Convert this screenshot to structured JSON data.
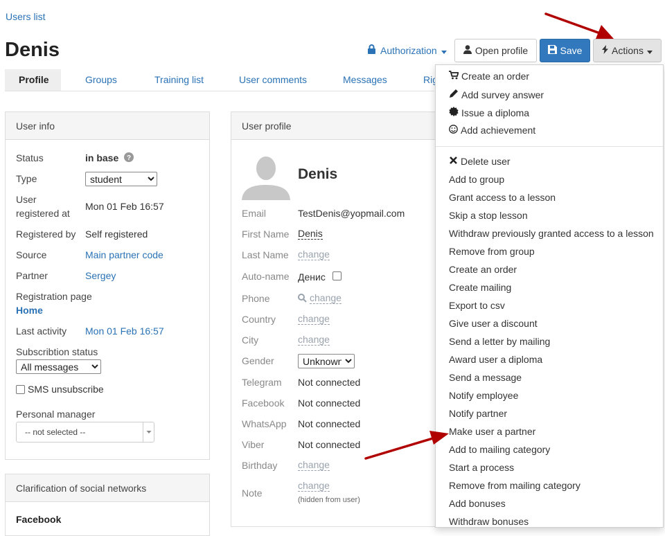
{
  "breadcrumb": "Users list",
  "title": "Denis",
  "header": {
    "authorization": "Authorization",
    "open_profile": "Open profile",
    "save": "Save",
    "actions": "Actions"
  },
  "tabs": [
    "Profile",
    "Groups",
    "Training list",
    "User comments",
    "Messages",
    "Rig"
  ],
  "user_info": {
    "heading": "User info",
    "status_label": "Status",
    "status_value": "in base",
    "type_label": "Type",
    "type_value": "student",
    "registered_label_1": "User",
    "registered_label_2": "registered at",
    "registered_value": "Mon 01 Feb 16:57",
    "registered_by_label": "Registered by",
    "registered_by_value": "Self registered",
    "source_label": "Source",
    "source_value": "Main partner code",
    "partner_label": "Partner",
    "partner_value": "Sergey",
    "registration_page_label": "Registration page",
    "registration_page_value": "Home",
    "last_activity_label": "Last activity",
    "last_activity_value": "Mon 01 Feb 16:57",
    "subscription_label": "Subscribtion status",
    "subscription_value": "All messages",
    "sms_unsubscribe": "SMS unsubscribe",
    "personal_manager_label": "Personal manager",
    "personal_manager_value": "-- not selected --"
  },
  "social": {
    "heading": "Clarification of social networks",
    "facebook": "Facebook"
  },
  "profile": {
    "heading": "User profile",
    "name": "Denis",
    "email_label": "Email",
    "email_value": "TestDenis@yopmail.com",
    "first_name_label": "First Name",
    "first_name_value": "Denis",
    "last_name_label": "Last Name",
    "change": "change",
    "auto_name_label": "Auto-name",
    "auto_name_value": "Денис",
    "phone_label": "Phone",
    "country_label": "Country",
    "city_label": "City",
    "gender_label": "Gender",
    "gender_value": "Unknown",
    "telegram_label": "Telegram",
    "facebook_label": "Facebook",
    "whatsapp_label": "WhatsApp",
    "viber_label": "Viber",
    "not_connected": "Not connected",
    "birthday_label": "Birthday",
    "note_label": "Note",
    "hidden_from_user": "(hidden from user)"
  },
  "actions_menu": {
    "group1": [
      {
        "label": "Create an order",
        "icon": "cart-icon"
      },
      {
        "label": "Add survey answer",
        "icon": "pencil-icon"
      },
      {
        "label": "Issue a diploma",
        "icon": "certificate-icon"
      },
      {
        "label": "Add achievement",
        "icon": "smile-icon"
      }
    ],
    "group2": [
      "Delete user",
      "Add to group",
      "Grant access to a lesson",
      "Skip a stop lesson",
      "Withdraw previously granted access to a lesson",
      "Remove from group",
      "Create an order",
      "Create mailing",
      "Export to csv",
      "Give user a discount",
      "Send a letter by mailing",
      "Award user a diploma",
      "Send a message",
      "Notify employee",
      "Notify partner",
      "Make user a partner",
      "Add to mailing category",
      "Start a process",
      "Remove from mailing category",
      "Add bonuses",
      "Withdraw bonuses"
    ]
  },
  "colors": {
    "link": "#2a72b5",
    "save_button": "#3278bd",
    "annotation_arrow": "#b00000"
  }
}
